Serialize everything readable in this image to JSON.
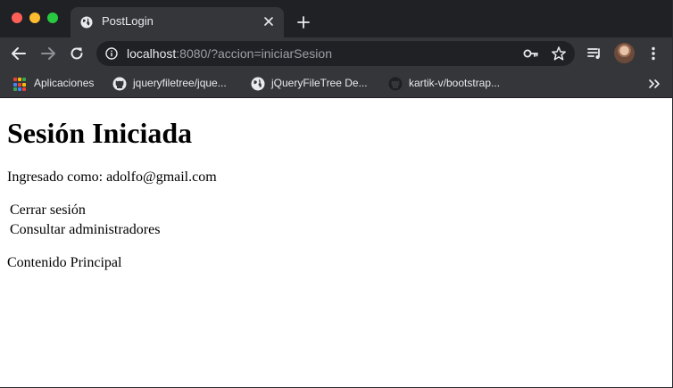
{
  "browser": {
    "tab": {
      "title": "PostLogin"
    },
    "address": {
      "host": "localhost",
      "rest": ":8080/?accion=iniciarSesion"
    },
    "bookmarks": [
      {
        "label": "Aplicaciones",
        "icon": "apps-grid-icon"
      },
      {
        "label": "jqueryfiletree/jque...",
        "icon": "github-icon"
      },
      {
        "label": "jQueryFileTree De...",
        "icon": "globe-icon"
      },
      {
        "label": "kartik-v/bootstrap...",
        "icon": "github-icon"
      }
    ],
    "colors": {
      "frame": "#202124",
      "toolbar": "#35363a",
      "text": "#e8eaed",
      "muted": "#9aa0a6"
    }
  },
  "page": {
    "title": "Sesión Iniciada",
    "logged_in": "Ingresado como: adolfo@gmail.com",
    "links": [
      "Cerrar sesión",
      "Consultar administradores"
    ],
    "main": "Contenido Principal"
  }
}
